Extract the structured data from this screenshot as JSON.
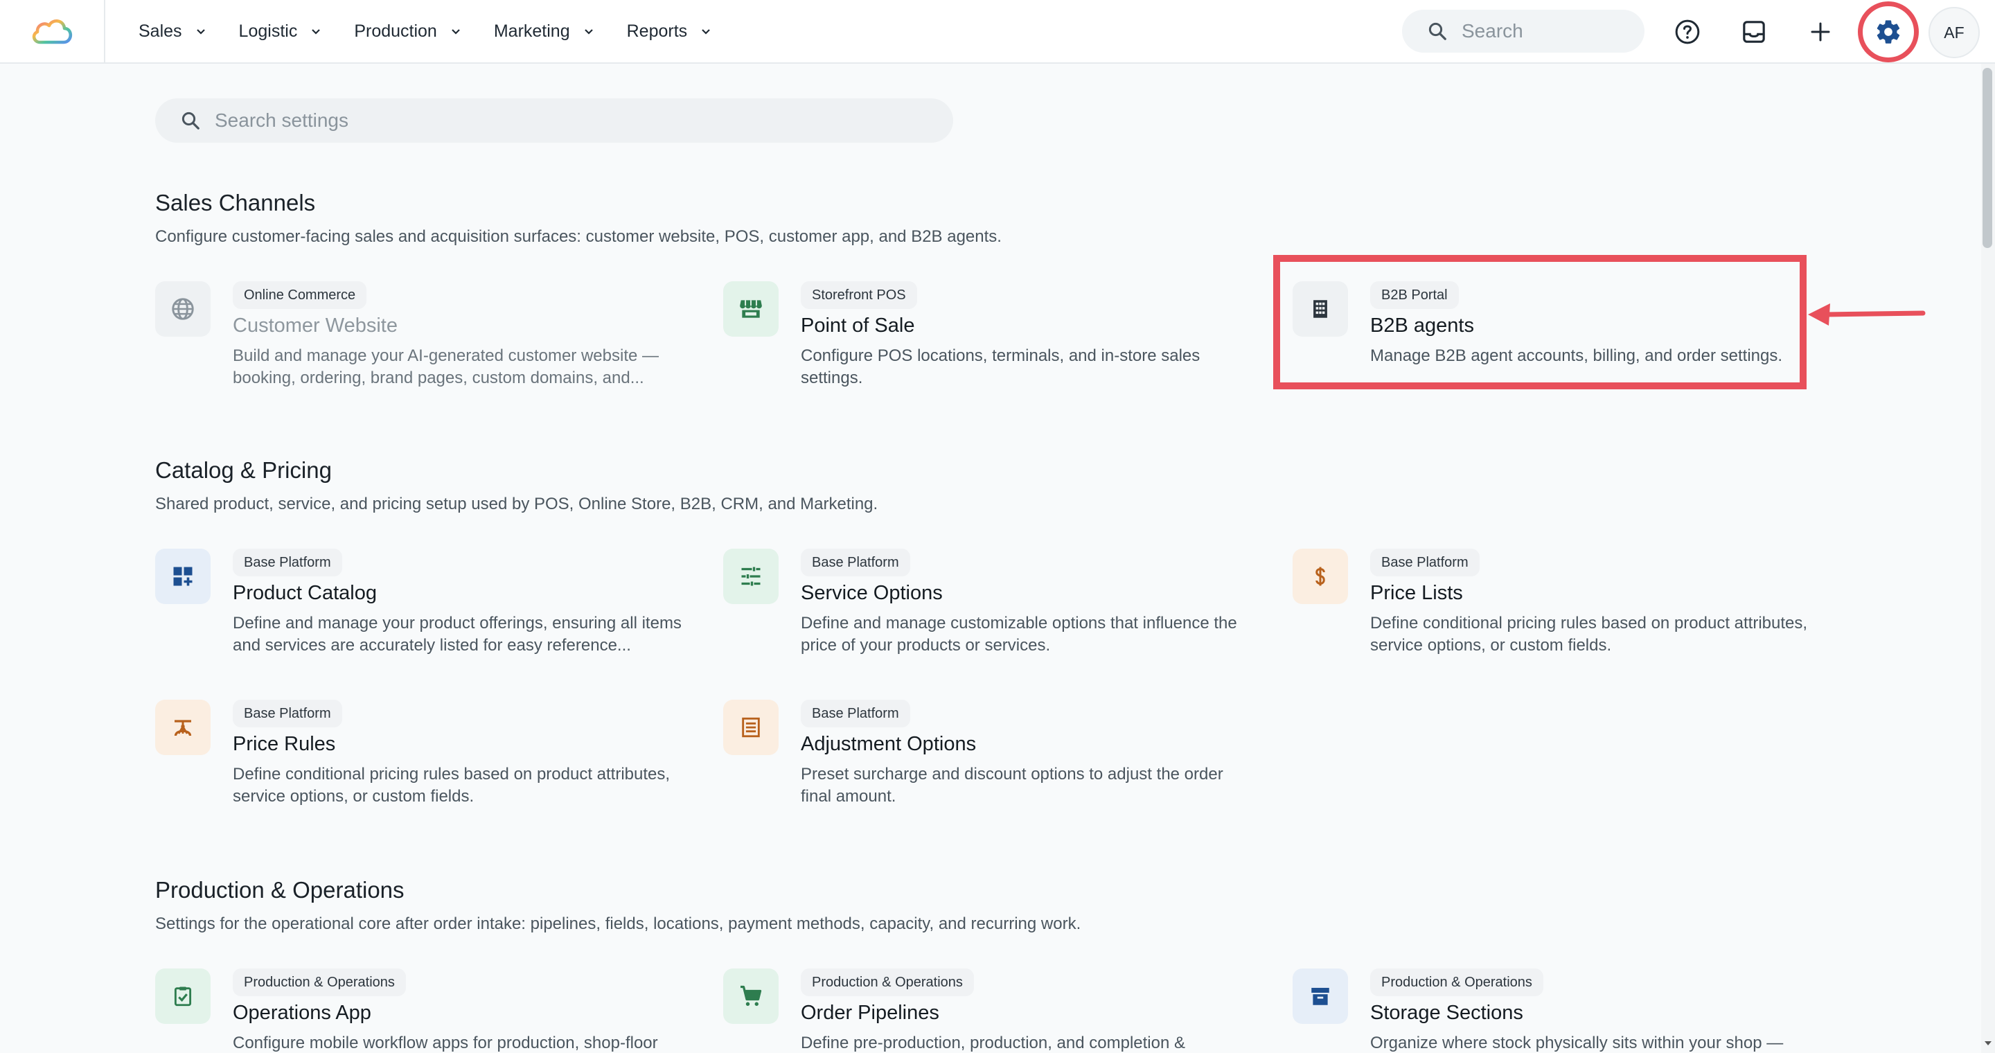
{
  "nav": {
    "items": [
      {
        "label": "Sales"
      },
      {
        "label": "Logistic"
      },
      {
        "label": "Production"
      },
      {
        "label": "Marketing"
      },
      {
        "label": "Reports"
      }
    ]
  },
  "topbar": {
    "search_placeholder": "Search",
    "avatar_initials": "AF"
  },
  "settings_search": {
    "placeholder": "Search settings"
  },
  "sections": [
    {
      "title": "Sales Channels",
      "description": "Configure customer-facing sales and acquisition surfaces: customer website, POS, customer app, and B2B agents.",
      "cards": [
        {
          "badge": "Online Commerce",
          "title": "Customer Website",
          "description": "Build and manage your AI-generated customer website — booking, ordering, brand pages, custom domains, and...",
          "icon": "globe-icon",
          "state": "disabled"
        },
        {
          "badge": "Storefront POS",
          "title": "Point of Sale",
          "description": "Configure POS locations, terminals, and in-store sales settings.",
          "icon": "storefront-icon"
        },
        {
          "badge": "B2B Portal",
          "title": "B2B agents",
          "description": "Manage B2B agent accounts, billing, and order settings.",
          "icon": "building-icon",
          "highlighted": true
        }
      ]
    },
    {
      "title": "Catalog & Pricing",
      "description": "Shared product, service, and pricing setup used by POS, Online Store, B2B, CRM, and Marketing.",
      "cards": [
        {
          "badge": "Base Platform",
          "title": "Product Catalog",
          "description": "Define and manage your product offerings, ensuring all items and services are accurately listed for easy reference...",
          "icon": "dashboard-add-icon"
        },
        {
          "badge": "Base Platform",
          "title": "Service Options",
          "description": "Define and manage customizable options that influence the price of your products or services.",
          "icon": "tune-icon"
        },
        {
          "badge": "Base Platform",
          "title": "Price Lists",
          "description": "Define conditional pricing rules based on product attributes, service options, or custom fields.",
          "icon": "dollar-icon"
        },
        {
          "badge": "Base Platform",
          "title": "Price Rules",
          "description": "Define conditional pricing rules based on product attributes, service options, or custom fields.",
          "icon": "scale-icon"
        },
        {
          "badge": "Base Platform",
          "title": "Adjustment Options",
          "description": "Preset surcharge and discount options to adjust the order final amount.",
          "icon": "receipt-icon"
        }
      ]
    },
    {
      "title": "Production & Operations",
      "description": "Settings for the operational core after order intake: pipelines, fields, locations, payment methods, capacity, and recurring work.",
      "cards": [
        {
          "badge": "Production & Operations",
          "title": "Operations App",
          "description": "Configure mobile workflow apps for production, shop-floor",
          "icon": "clipboard-check-icon"
        },
        {
          "badge": "Production & Operations",
          "title": "Order Pipelines",
          "description": "Define pre-production, production, and completion &",
          "icon": "cart-icon"
        },
        {
          "badge": "Production & Operations",
          "title": "Storage Sections",
          "description": "Organize where stock physically sits within your shop —",
          "icon": "archive-icon"
        }
      ]
    }
  ],
  "colors": {
    "accent_blue": "#1d4f91",
    "highlight_red": "#e8505b",
    "green_tint": "#e3f3ea",
    "orange_tint": "#fbeee1",
    "blue_tint": "#e6eef8",
    "gray_tint": "#eef1f3"
  }
}
